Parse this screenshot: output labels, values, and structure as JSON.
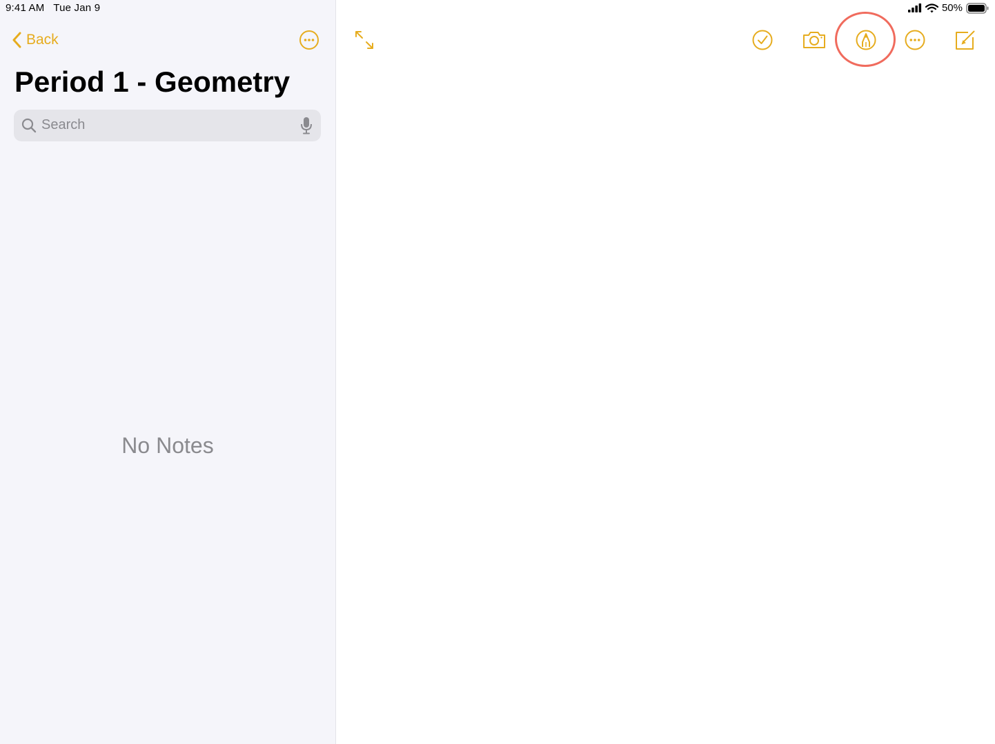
{
  "status_bar": {
    "time": "9:41 AM",
    "date": "Tue Jan 9",
    "battery_percent": "50%",
    "battery_level": 0.5,
    "icons": [
      "cellular-signal-icon",
      "wifi-icon",
      "battery-icon"
    ]
  },
  "sidebar": {
    "back_label": "Back",
    "folder_title": "Period 1 - Geometry",
    "search_placeholder": "Search",
    "empty_message": "No Notes",
    "icons": [
      "chevron-left-icon",
      "ellipsis-circle-icon",
      "magnifying-glass-icon",
      "microphone-icon"
    ]
  },
  "toolbar": {
    "buttons": [
      "expand-icon",
      "checklist-icon",
      "camera-icon",
      "markup-pen-icon",
      "ellipsis-circle-icon",
      "compose-icon"
    ],
    "highlighted": "markup-pen-icon"
  },
  "colors": {
    "accent": "#e6ac1e",
    "sidebar_bg": "#f5f5fa",
    "search_bg": "#e5e5ea",
    "placeholder": "#8a8a8f",
    "highlight_ring": "#f06b5d"
  }
}
